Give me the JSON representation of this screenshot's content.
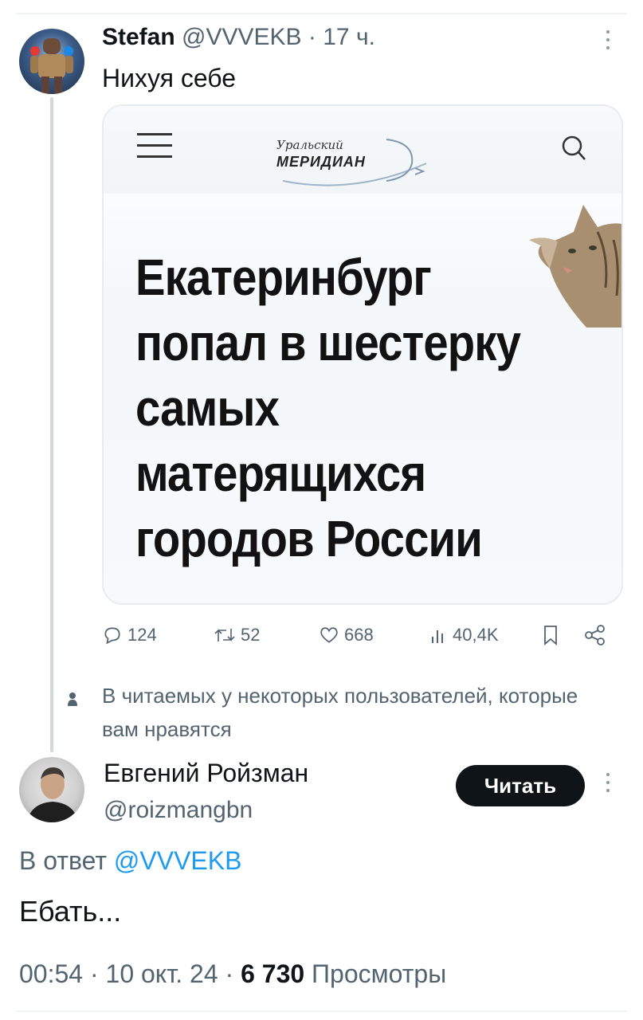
{
  "tweet1": {
    "author_name": "Stefan",
    "handle": "@VVVEKB",
    "separator": "·",
    "time": "17 ч.",
    "text": "Нихуя себе",
    "card": {
      "logo_top": "Уральский",
      "logo_main": "МЕРИДИАН",
      "headline_lines": [
        "Екатеринбург",
        "попал в шестерку",
        "самых",
        "матерящихся",
        "городов России"
      ]
    },
    "stats": {
      "replies": "124",
      "reposts": "52",
      "likes": "668",
      "views": "40,4K"
    }
  },
  "recommendation_notice": "В читаемых у некоторых пользователей, которые вам нравятся",
  "tweet2": {
    "author_name": "Евгений Ройзман",
    "handle": "@roizmangbn",
    "follow_label": "Читать",
    "reply_prefix": "В ответ",
    "reply_mention": "@VVVEKB",
    "text": "Ебать...",
    "time": "00:54",
    "date": "10 окт. 24",
    "views_count": "6 730",
    "views_label": "Просмотры",
    "separator": "·"
  },
  "colors": {
    "text_primary": "#0f1419",
    "text_secondary": "#536471",
    "link": "#1d9bf0",
    "button_bg": "#0f1419"
  },
  "icons": [
    "more-icon",
    "menu-icon",
    "search-icon",
    "reply-icon",
    "repost-icon",
    "like-icon",
    "views-icon",
    "bookmark-icon",
    "share-icon",
    "person-icon"
  ]
}
